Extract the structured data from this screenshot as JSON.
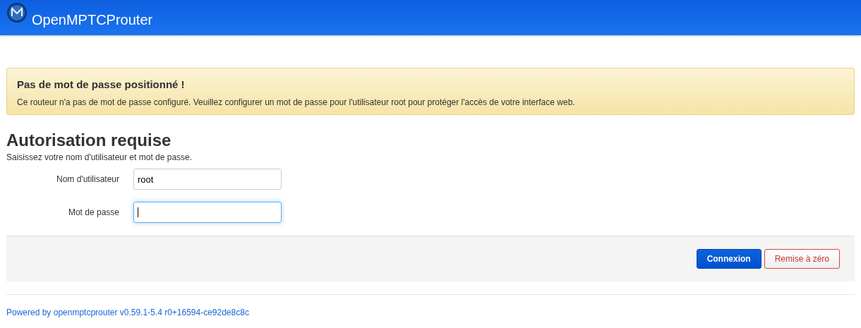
{
  "header": {
    "brand": "OpenMPTCProuter"
  },
  "alert": {
    "title": "Pas de mot de passe positionné !",
    "message": "Ce routeur n'a pas de mot de passe configuré. Veuillez configurer un mot de passe pour l'utilisateur root pour protéger l'accès de votre interface web."
  },
  "login": {
    "title": "Autorisation requise",
    "description": "Saisissez votre nom d'utilisateur et mot de passe.",
    "fields": [
      {
        "label": "Nom d'utilisateur",
        "value": "root",
        "focused": false
      },
      {
        "label": "Mot de passe",
        "focused": true
      }
    ],
    "buttons": [
      {
        "label": "Connexion",
        "kind": "primary"
      },
      {
        "label": "Remise à zéro",
        "kind": "reset"
      }
    ]
  },
  "footer": {
    "link": "Powered by openmptcprouter v0.59.1-5.4 r0+16594-ce92de8c8c"
  }
}
